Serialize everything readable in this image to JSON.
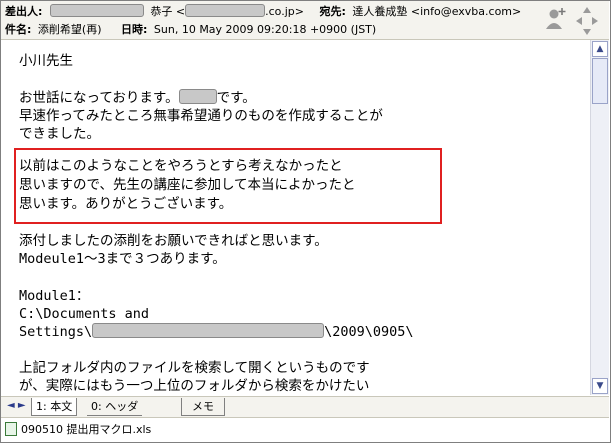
{
  "header": {
    "from_label": "差出人:",
    "from_name": "恭子",
    "from_domain": ".co.jp>",
    "to_label": "宛先:",
    "to_value": "達人養成塾 <info@exvba.com>",
    "subject_label": "件名:",
    "subject_value": "添削希望(再)",
    "date_label": "日時:",
    "date_value": "Sun, 10 May 2009 09:20:18 +0900 (JST)"
  },
  "body": {
    "lines": [
      "小川先生",
      "",
      "お世話になっております。",
      "早速作ってみたところ無事希望通りのものを作成することが",
      "できました。",
      "",
      "以前はこのようなことをやろうとすら考えなかったと",
      "思いますので、先生の講座に参加して本当によかったと",
      "思います。ありがとうございます。",
      "",
      "添付しましたの添削をお願いできればと思います。",
      "Modeule1～3まで３つあります。",
      "",
      "Module1：",
      "C:\\Documents and",
      "Settings\\",
      "",
      "上記フォルダ内のファイルを検索して開くというものです",
      "が、実際にはもう一つ上位のフォルダから検索をかけたい"
    ],
    "greeting_suffix": "です。",
    "path_suffix": "\\2009\\0905\\"
  },
  "tabs": [
    {
      "label": "1: 本文"
    },
    {
      "label": "0: ヘッダ"
    },
    {
      "label": "メモ"
    }
  ],
  "attachment": {
    "filename": "090510 提出用マクロ.xls",
    "icon": "excel-file-icon"
  },
  "colors": {
    "highlight_border": "#e02020",
    "header_bg": "#f4f3ee"
  }
}
